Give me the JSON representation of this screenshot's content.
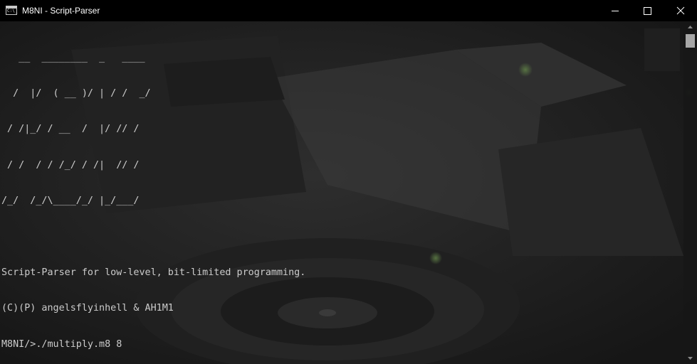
{
  "window": {
    "title": "M8NI - Script-Parser",
    "icon": "console-icon",
    "icon_text": "C:\\_",
    "controls": [
      "minimize-icon",
      "maximize-icon",
      "close-icon"
    ]
  },
  "console": {
    "ascii_logo": [
      "   __  ________  _   ____",
      "  /  |/  ( __ )/ | / /  _/",
      " / /|_/ / __  /  |/ // /",
      " / /  / / /_/ / /|  // /",
      "/_/  /_/\\____/_/ |_/___/"
    ],
    "tagline": "Script-Parser for low-level, bit-limited programming.",
    "copyright": "(C)(P) angelsflyinhell & AH1M1",
    "prompt": "M8NI/>",
    "command": "./multiply.m8 8"
  },
  "colors": {
    "titlebar_bg": "#000000",
    "console_text": "#cccccc",
    "scroll_thumb": "#a6a6a6"
  }
}
